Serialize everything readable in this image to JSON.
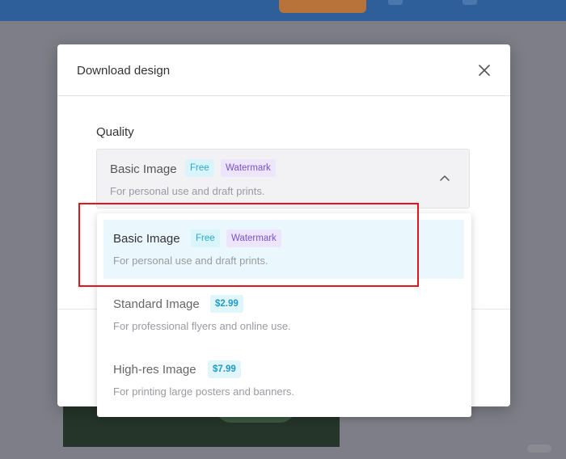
{
  "modal": {
    "title": "Download design",
    "quality_label": "Quality"
  },
  "select": {
    "title": "Basic Image",
    "badges": [
      "Free",
      "Watermark"
    ],
    "description": "For personal use and draft prints."
  },
  "options": [
    {
      "title": "Basic Image",
      "badges": [
        "Free",
        "Watermark"
      ],
      "description": "For personal use and draft prints.",
      "selected": true
    },
    {
      "title": "Standard Image",
      "badges": [
        "$2.99"
      ],
      "description": "For professional flyers and online use.",
      "selected": false
    },
    {
      "title": "High-res Image",
      "badges": [
        "$7.99"
      ],
      "description": "For printing large posters and banners.",
      "selected": false
    }
  ],
  "icons": {
    "close": "close-icon",
    "chevron": "chevron-up-icon"
  },
  "colors": {
    "highlight": "#e3161b",
    "selected_bg": "#eaf8fe",
    "free_badge": "#2aa7c9",
    "watermark_badge": "#7b52c7",
    "price_badge": "#1d9bc4"
  }
}
